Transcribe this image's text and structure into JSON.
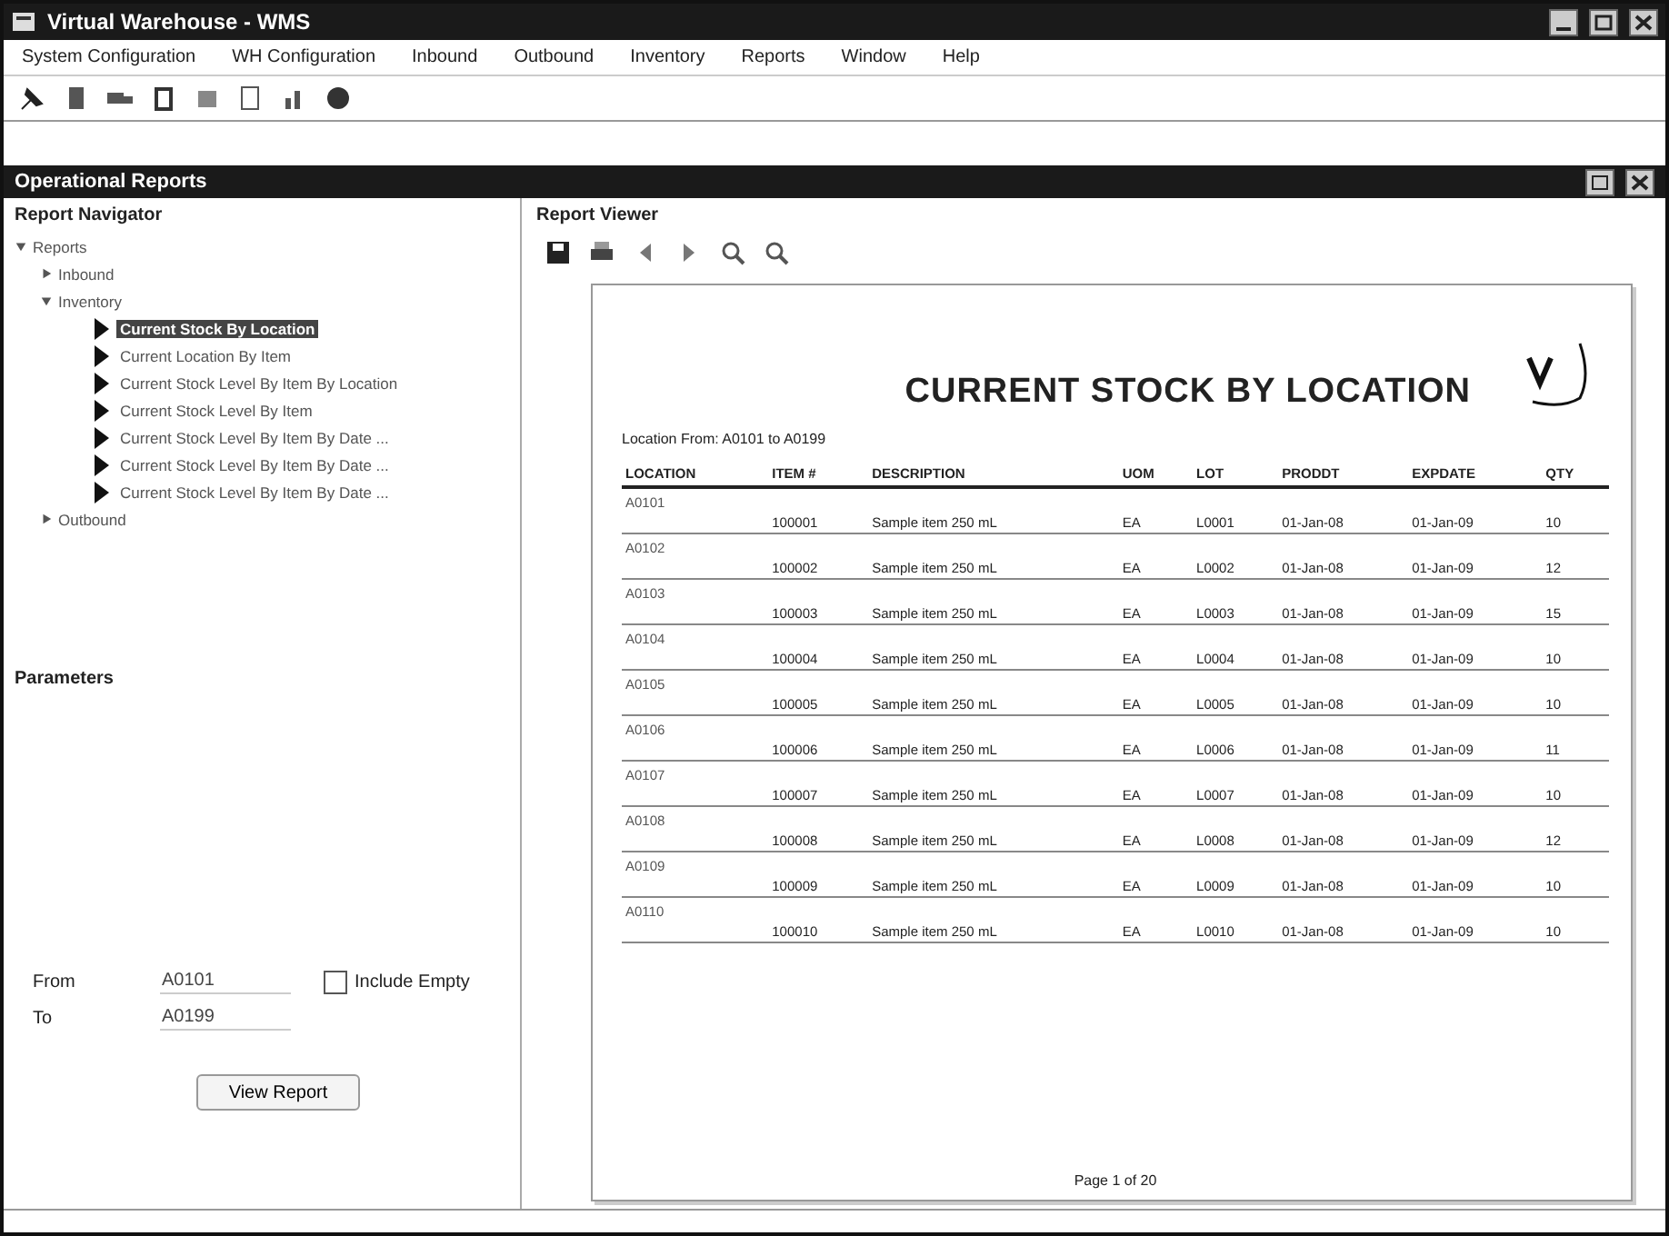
{
  "window": {
    "title": "Virtual Warehouse - WMS"
  },
  "menu": [
    "System Configuration",
    "WH Configuration",
    "Inbound",
    "Outbound",
    "Inventory",
    "Reports",
    "Window",
    "Help"
  ],
  "panel": {
    "title": "Operational Reports"
  },
  "navigator": {
    "title": "Report Navigator",
    "tree": [
      {
        "label": "Reports",
        "expanded": true,
        "children": [
          {
            "label": "Inbound",
            "expanded": false
          },
          {
            "label": "Inventory",
            "expanded": true,
            "children": [
              {
                "label": "Current Stock By Location",
                "selected": true
              },
              {
                "label": "Current Location By Item",
                "selected": false
              },
              {
                "label": "Current Stock Level By Item By Location",
                "selected": false
              },
              {
                "label": "Current Stock Level By Item",
                "selected": false
              },
              {
                "label": "Current Stock Level By Item By Date ...",
                "selected": false
              },
              {
                "label": "Current Stock Level By Item By Date ...",
                "selected": false
              },
              {
                "label": "Current Stock Level By Item By Date ...",
                "selected": false
              }
            ]
          },
          {
            "label": "Outbound",
            "expanded": false
          }
        ]
      }
    ]
  },
  "parameters": {
    "title": "Parameters",
    "fields": [
      {
        "label": "From",
        "value": "A0101"
      },
      {
        "label": "To",
        "value": "A0199"
      }
    ],
    "check_label": "Include Empty",
    "checked": false,
    "button": "View Report"
  },
  "viewer": {
    "title": "Report Viewer",
    "report": {
      "title": "CURRENT STOCK BY LOCATION",
      "subtitle": "Location From: A0101 to A0199",
      "columns": [
        "LOCATION",
        "ITEM #",
        "DESCRIPTION",
        "UOM",
        "LOT",
        "PRODDT",
        "EXPDATE",
        "QTY"
      ],
      "rows": [
        {
          "location": "A0101",
          "item": "100001",
          "description": "Sample item 250 mL",
          "uom": "EA",
          "lot": "L0001",
          "prod": "01-Jan-08",
          "exp": "01-Jan-09",
          "qty": "10"
        },
        {
          "location": "A0102",
          "item": "100002",
          "description": "Sample item 250 mL",
          "uom": "EA",
          "lot": "L0002",
          "prod": "01-Jan-08",
          "exp": "01-Jan-09",
          "qty": "12"
        },
        {
          "location": "A0103",
          "item": "100003",
          "description": "Sample item 250 mL",
          "uom": "EA",
          "lot": "L0003",
          "prod": "01-Jan-08",
          "exp": "01-Jan-09",
          "qty": "15"
        },
        {
          "location": "A0104",
          "item": "100004",
          "description": "Sample item 250 mL",
          "uom": "EA",
          "lot": "L0004",
          "prod": "01-Jan-08",
          "exp": "01-Jan-09",
          "qty": "10"
        },
        {
          "location": "A0105",
          "item": "100005",
          "description": "Sample item 250 mL",
          "uom": "EA",
          "lot": "L0005",
          "prod": "01-Jan-08",
          "exp": "01-Jan-09",
          "qty": "10"
        },
        {
          "location": "A0106",
          "item": "100006",
          "description": "Sample item 250 mL",
          "uom": "EA",
          "lot": "L0006",
          "prod": "01-Jan-08",
          "exp": "01-Jan-09",
          "qty": "11"
        },
        {
          "location": "A0107",
          "item": "100007",
          "description": "Sample item 250 mL",
          "uom": "EA",
          "lot": "L0007",
          "prod": "01-Jan-08",
          "exp": "01-Jan-09",
          "qty": "10"
        },
        {
          "location": "A0108",
          "item": "100008",
          "description": "Sample item 250 mL",
          "uom": "EA",
          "lot": "L0008",
          "prod": "01-Jan-08",
          "exp": "01-Jan-09",
          "qty": "12"
        },
        {
          "location": "A0109",
          "item": "100009",
          "description": "Sample item 250 mL",
          "uom": "EA",
          "lot": "L0009",
          "prod": "01-Jan-08",
          "exp": "01-Jan-09",
          "qty": "10"
        },
        {
          "location": "A0110",
          "item": "100010",
          "description": "Sample item 250 mL",
          "uom": "EA",
          "lot": "L0010",
          "prod": "01-Jan-08",
          "exp": "01-Jan-09",
          "qty": "10"
        }
      ],
      "page": "Page 1 of 20"
    }
  }
}
